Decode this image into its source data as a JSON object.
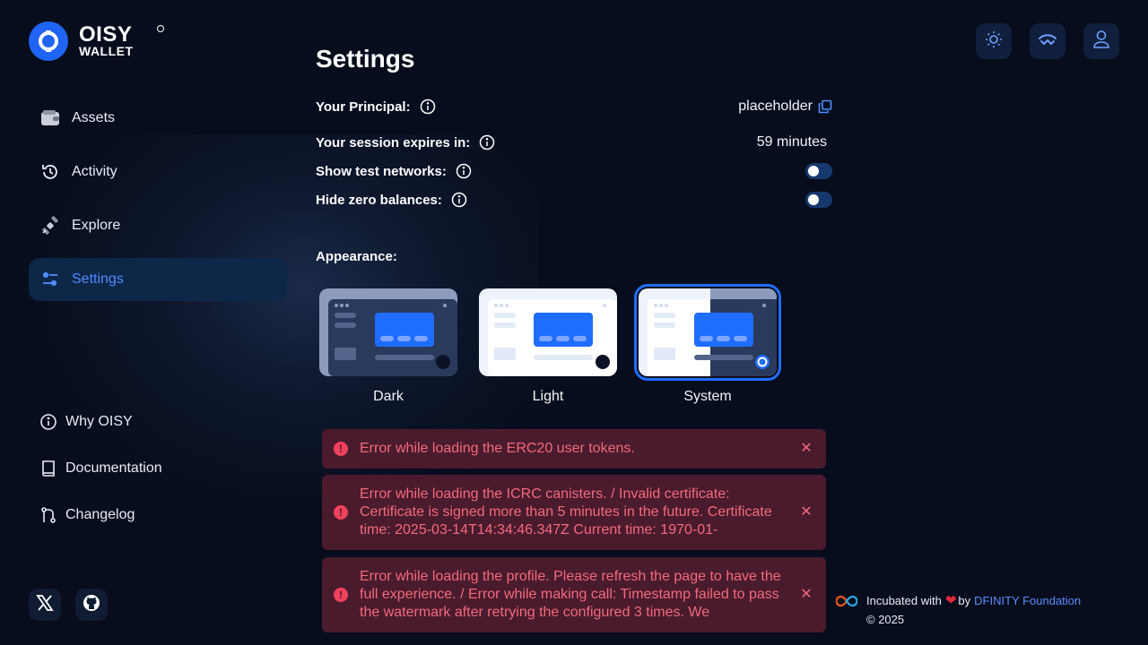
{
  "brand": {
    "line1": "OISY",
    "line2": "WALLET"
  },
  "nav": [
    {
      "label": "Assets",
      "icon": "wallet-icon"
    },
    {
      "label": "Activity",
      "icon": "history-icon"
    },
    {
      "label": "Explore",
      "icon": "satellite-icon"
    },
    {
      "label": "Settings",
      "icon": "sliders-icon",
      "active": true
    }
  ],
  "footer_links": [
    {
      "label": "Why OISY",
      "icon": "info-icon"
    },
    {
      "label": "Documentation",
      "icon": "book-icon"
    },
    {
      "label": "Changelog",
      "icon": "git-branch-icon"
    }
  ],
  "page": {
    "title": "Settings"
  },
  "settings": {
    "principal": {
      "label": "Your Principal:",
      "value": "placeholder"
    },
    "session": {
      "label": "Your session expires in:",
      "value": "59 minutes"
    },
    "test_networks": {
      "label": "Show test networks:",
      "enabled": false
    },
    "zero_balances": {
      "label": "Hide zero balances:",
      "enabled": false
    }
  },
  "appearance": {
    "label": "Appearance:",
    "options": [
      "Dark",
      "Light",
      "System"
    ],
    "selected": "System"
  },
  "alerts": [
    "Error while loading the ERC20 user tokens.",
    "Error while loading the ICRC canisters. / Invalid certificate: Certificate is signed more than 5 minutes in the future. Certificate time: 2025-03-14T14:34:46.347Z Current time: 1970-01-",
    "Error while loading the profile. Please refresh the page to have the full experience. / Error while making call: Timestamp failed to pass the watermark after retrying the configured 3 times. We"
  ],
  "credit": {
    "prefix": "Incubated with",
    "by": "by",
    "org": "DFINITY Foundation",
    "copyright": "© 2025"
  },
  "colors": {
    "accent": "#1f6dff",
    "background": "#070d1c",
    "error_bg": "#4a1b2d",
    "error_text": "#f26a7c"
  }
}
